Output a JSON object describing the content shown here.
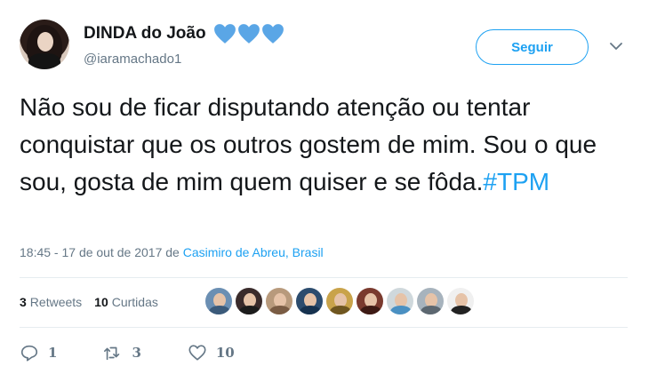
{
  "user": {
    "display_name": "DINDA do João",
    "handle": "@iaramachado1",
    "name_hearts": [
      "blue-heart-icon",
      "blue-heart-icon",
      "blue-heart-icon"
    ]
  },
  "follow_button": {
    "label": "Seguir"
  },
  "tweet": {
    "text": "Não sou de ficar disputando atenção ou tentar conquistar que os outros gostem de mim. Sou o que sou, gosta de mim quem quiser e se fôda.",
    "hashtag": "#TPM"
  },
  "meta": {
    "time": "18:45 - 17 de out de 2017",
    "from_word": "de",
    "location": "Casimiro de Abreu, Brasil"
  },
  "stats": {
    "retweets_count": "3",
    "retweets_label": "Retweets",
    "likes_count": "10",
    "likes_label": "Curtidas"
  },
  "actions": {
    "replies": "1",
    "retweets": "3",
    "likes": "10"
  },
  "colors": {
    "accent": "#1da1f2",
    "text": "#14171a",
    "muted": "#657786",
    "divider": "#e6ecf0",
    "heart": "#5aa6e6"
  },
  "liker_avatars": [
    {
      "bg": "#6b8fb3",
      "shirt": "#3b5a7a"
    },
    {
      "bg": "#3a2b2b",
      "shirt": "#1c1c1c"
    },
    {
      "bg": "#b89a7c",
      "shirt": "#7a5c44"
    },
    {
      "bg": "#2c4c6e",
      "shirt": "#16324f"
    },
    {
      "bg": "#c9a34a",
      "shirt": "#6f5620"
    },
    {
      "bg": "#7a3a2e",
      "shirt": "#3d1a14"
    },
    {
      "bg": "#cfd8dc",
      "shirt": "#4a90c2"
    },
    {
      "bg": "#a7b3bd",
      "shirt": "#5c6770"
    },
    {
      "bg": "#f0f0f0",
      "shirt": "#222222"
    }
  ]
}
